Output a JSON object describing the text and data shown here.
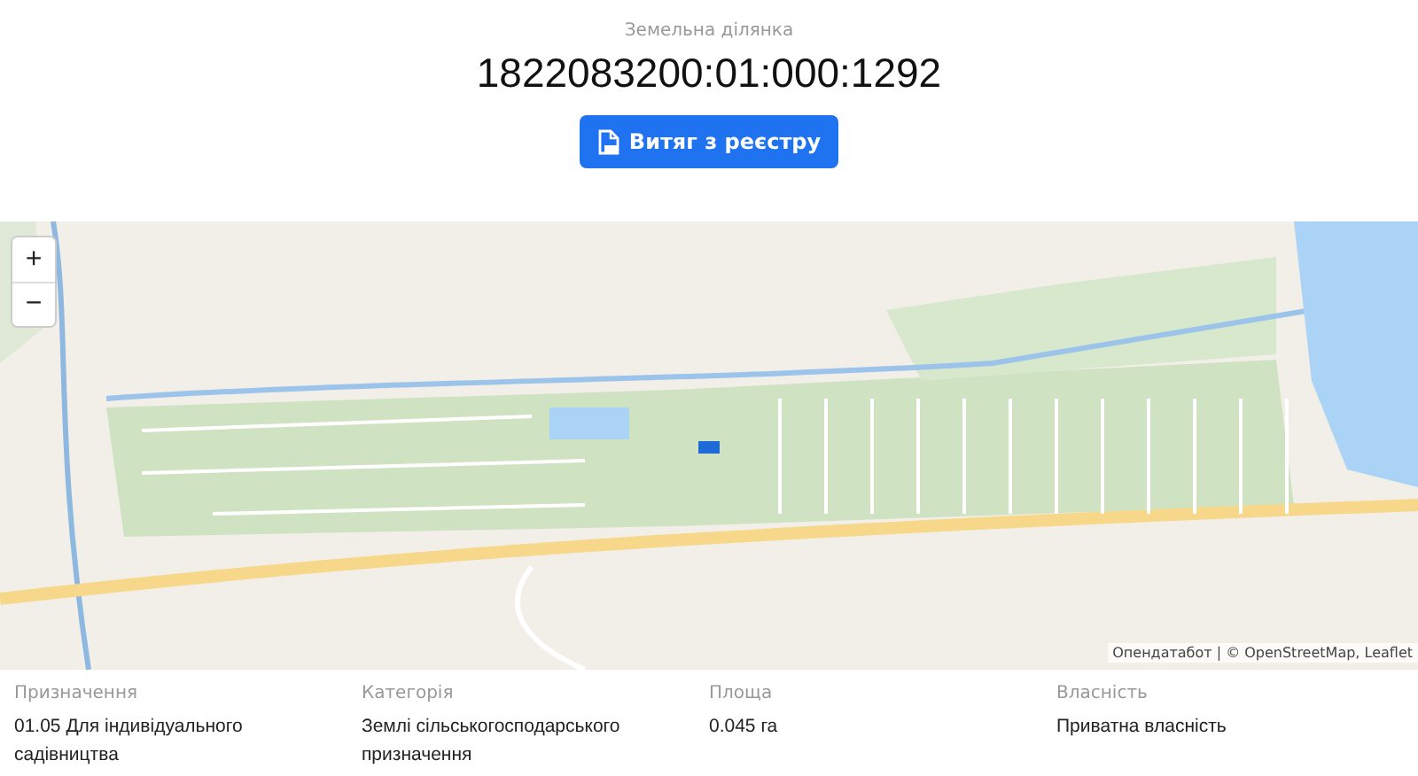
{
  "header": {
    "subtitle": "Земельна ділянка",
    "cadastral_number": "1822083200:01:000:1292",
    "button": {
      "label": "Витяг з реєстру"
    }
  },
  "map": {
    "zoom_in": "+",
    "zoom_out": "−",
    "attribution": "Опендатабот | © OpenStreetMap, Leaflet"
  },
  "details": [
    {
      "label": "Призначення",
      "value": "01.05 Для індивідуального садівництва"
    },
    {
      "label": "Категорія",
      "value": "Землі сільськогосподарського призначення"
    },
    {
      "label": "Площа",
      "value": "0.045 га"
    },
    {
      "label": "Власність",
      "value": "Приватна власність"
    }
  ]
}
